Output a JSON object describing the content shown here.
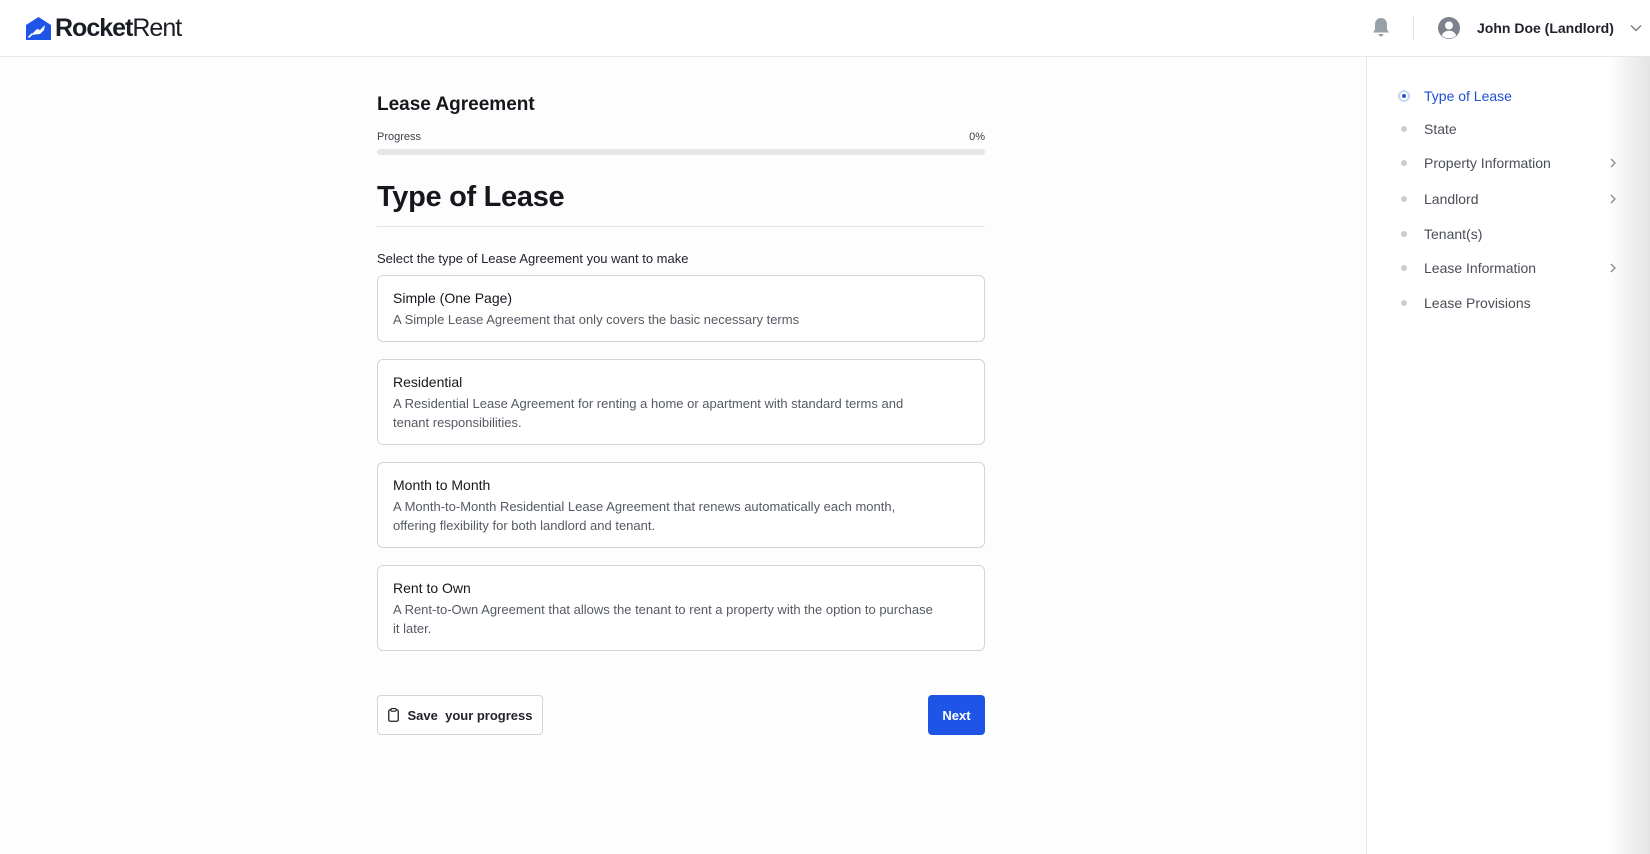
{
  "brand": {
    "name_bold": "Rocket",
    "name_light": "Rent",
    "color": "#1f55e6"
  },
  "header": {
    "notification_icon": "bell-icon",
    "user_name": "John Doe (Landlord)",
    "avatar_icon": "user-circle-icon",
    "menu_icon": "chevron-down-icon"
  },
  "form": {
    "title": "Lease Agreement",
    "progress_label": "Progress",
    "progress_text": "0%",
    "progress_fraction": 0
  },
  "section": {
    "title": "Type of Lease",
    "prompt": "Select the type of Lease Agreement you want to make"
  },
  "options": [
    {
      "title": "Simple (One Page)",
      "description": "A Simple Lease Agreement that only covers the basic necessary terms"
    },
    {
      "title": "Residential",
      "description": "A Residential Lease Agreement for renting a home or apartment with standard terms and tenant responsibilities."
    },
    {
      "title": "Month to Month",
      "description": "A Month-to-Month Residential Lease Agreement that renews automatically each month, offering flexibility for both landlord and tenant."
    },
    {
      "title": "Rent to Own",
      "description": "A Rent-to-Own Agreement that allows the tenant to rent a property with the option to purchase it later."
    }
  ],
  "actions": {
    "save_label": "Save  your progress",
    "save_icon": "clipboard-icon",
    "next_label": "Next"
  },
  "steps": [
    {
      "label": "Type of Lease",
      "active": true,
      "has_children": false
    },
    {
      "label": "State",
      "active": false,
      "has_children": false
    },
    {
      "label": "Property Information",
      "active": false,
      "has_children": true
    },
    {
      "label": "Landlord",
      "active": false,
      "has_children": true
    },
    {
      "label": "Tenant(s)",
      "active": false,
      "has_children": false
    },
    {
      "label": "Lease Information",
      "active": false,
      "has_children": true
    },
    {
      "label": "Lease Provisions",
      "active": false,
      "has_children": false
    }
  ]
}
